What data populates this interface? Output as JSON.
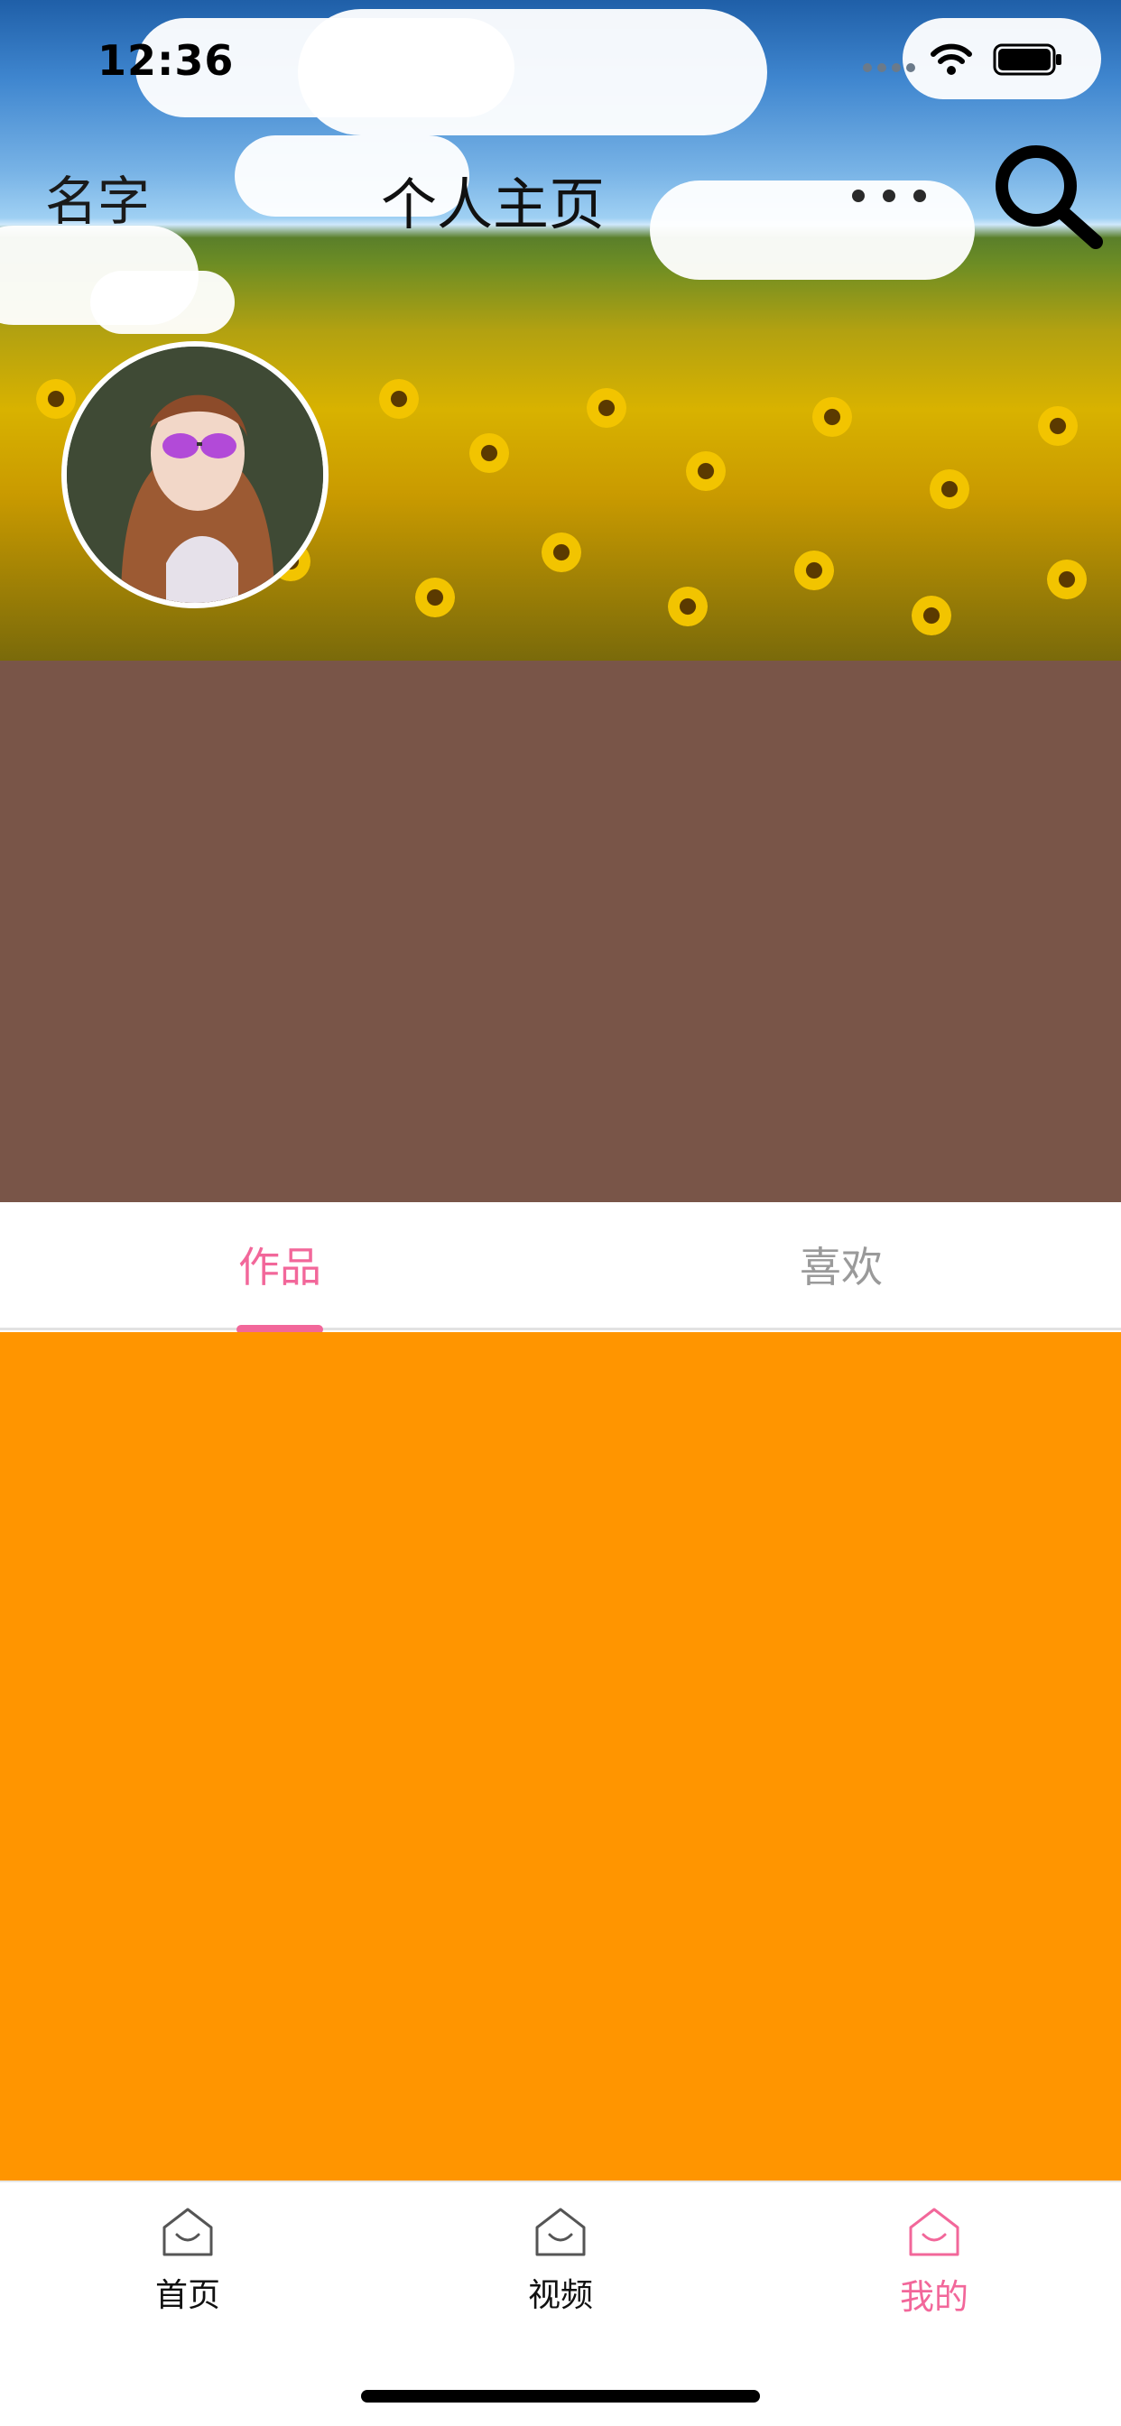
{
  "status_bar": {
    "time": "12:36"
  },
  "nav": {
    "name": "名字",
    "title": "个人主页"
  },
  "tabs": [
    {
      "label": "作品",
      "selected": true
    },
    {
      "label": "喜欢",
      "selected": false
    }
  ],
  "bottom_tabs": [
    {
      "label": "首页",
      "icon": "home-icon",
      "selected": false
    },
    {
      "label": "视频",
      "icon": "home-icon",
      "selected": false
    },
    {
      "label": "我的",
      "icon": "home-icon",
      "selected": true
    }
  ],
  "colors": {
    "accent": "#f2679a",
    "brown_block": "#795548",
    "content_orange": "#ff9500"
  }
}
